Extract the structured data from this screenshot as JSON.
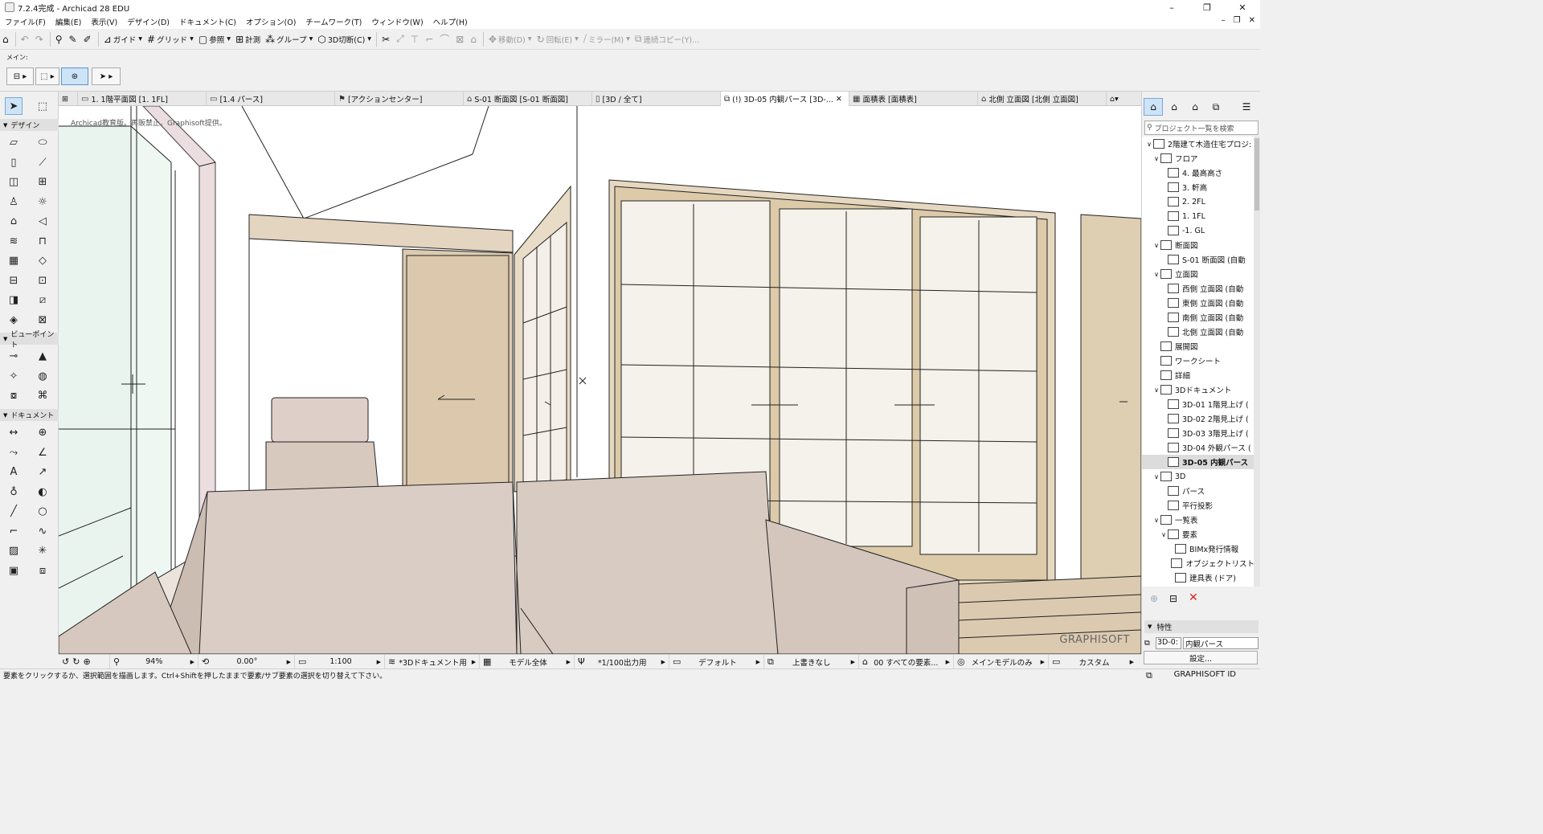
{
  "window": {
    "title": "7.2.4完成 - Archicad 28 EDU",
    "controls": [
      "–",
      "❐",
      "✕"
    ]
  },
  "menu": [
    "ファイル(F)",
    "編集(E)",
    "表示(V)",
    "デザイン(D)",
    "ドキュメント(C)",
    "オプション(O)",
    "チームワーク(T)",
    "ウィンドウ(W)",
    "ヘルプ(H)"
  ],
  "menu_right": [
    "–",
    "❐",
    "✕"
  ],
  "toolbar": {
    "guide": "ガイド",
    "grid": "グリッド",
    "reference": "参照",
    "measure": "計測",
    "group": "グループ",
    "cut3d": "3D切断(C)",
    "move": "移動(D)",
    "rotate": "回転(E)",
    "mirror": "ミラー(M)",
    "multiply": "連続コピー(Y)..."
  },
  "infobox": {
    "label": "メイン:"
  },
  "tabs": [
    {
      "label": "1. 1階平面図 [1. 1FL]",
      "icon": "floorplan-icon"
    },
    {
      "label": "[1.4 パース]",
      "icon": "perspective-icon"
    },
    {
      "label": "[アクションセンター]",
      "icon": "action-center-icon"
    },
    {
      "label": "S-01 断面図 [S-01 断面図]",
      "icon": "section-icon"
    },
    {
      "label": "[3D / 全て]",
      "icon": "3d-icon"
    },
    {
      "label": "(!) 3D-05 内観パース [3D-...",
      "icon": "3d-document-icon",
      "active": true
    },
    {
      "label": "面積表 [面積表]",
      "icon": "schedule-icon"
    },
    {
      "label": "北側 立面図 [北側 立面図]",
      "icon": "elevation-icon"
    }
  ],
  "toolbox": {
    "design": "デザイン",
    "viewpoint": "ビューポイント",
    "document": "ドキュメント"
  },
  "viewport": {
    "watermark": "Archicad教育版。再販禁止。Graphisoft提供。",
    "brand": "GRAPHISOFT"
  },
  "navigator": {
    "search_placeholder": "プロジェクト一覧を検索",
    "tree": [
      {
        "label": "2階建て木造住宅プロジ:",
        "level": 0,
        "chev": "∨"
      },
      {
        "label": "フロア",
        "level": 1,
        "chev": "∨"
      },
      {
        "label": "4. 最高高さ",
        "level": 2,
        "chev": ""
      },
      {
        "label": "3. 軒高",
        "level": 2,
        "chev": ""
      },
      {
        "label": "2. 2FL",
        "level": 2,
        "chev": ""
      },
      {
        "label": "1. 1FL",
        "level": 2,
        "chev": ""
      },
      {
        "label": "-1. GL",
        "level": 2,
        "chev": ""
      },
      {
        "label": "断面図",
        "level": 1,
        "chev": "∨"
      },
      {
        "label": "S-01 断面図 (自動",
        "level": 2,
        "chev": ""
      },
      {
        "label": "立面図",
        "level": 1,
        "chev": "∨"
      },
      {
        "label": "西側 立面図 (自動",
        "level": 2,
        "chev": ""
      },
      {
        "label": "東側 立面図 (自動",
        "level": 2,
        "chev": ""
      },
      {
        "label": "南側 立面図 (自動",
        "level": 2,
        "chev": ""
      },
      {
        "label": "北側 立面図 (自動",
        "level": 2,
        "chev": ""
      },
      {
        "label": "展開図",
        "level": 1,
        "chev": ""
      },
      {
        "label": "ワークシート",
        "level": 1,
        "chev": ""
      },
      {
        "label": "詳細",
        "level": 1,
        "chev": ""
      },
      {
        "label": "3Dドキュメント",
        "level": 1,
        "chev": "∨"
      },
      {
        "label": "3D-01 1階見上げ (",
        "level": 2,
        "chev": ""
      },
      {
        "label": "3D-02 2階見上げ (",
        "level": 2,
        "chev": ""
      },
      {
        "label": "3D-03 3階見上げ (",
        "level": 2,
        "chev": ""
      },
      {
        "label": "3D-04 外観パース (",
        "level": 2,
        "chev": ""
      },
      {
        "label": "3D-05 内観パース",
        "level": 2,
        "chev": "",
        "selected": true
      },
      {
        "label": "3D",
        "level": 1,
        "chev": "∨"
      },
      {
        "label": "パース",
        "level": 2,
        "chev": ""
      },
      {
        "label": "平行投影",
        "level": 2,
        "chev": ""
      },
      {
        "label": "一覧表",
        "level": 1,
        "chev": "∨"
      },
      {
        "label": "要素",
        "level": 2,
        "chev": "∨"
      },
      {
        "label": "BIMx発行情報",
        "level": 3,
        "chev": ""
      },
      {
        "label": "オブジェクトリスト",
        "level": 3,
        "chev": ""
      },
      {
        "label": "建具表 (ドア)",
        "level": 3,
        "chev": ""
      }
    ],
    "properties_title": "特性",
    "prop_id": "3D-0:",
    "prop_name": "内観パース",
    "settings_button": "設定..."
  },
  "statusrow": {
    "zoom": "94%",
    "angle": "0.00°",
    "scale": "1:100",
    "layer": "*3Dドキュメント用",
    "model": "モデル全体",
    "pen": "*1/100出力用",
    "display": "デフォルト",
    "override": "上書きなし",
    "renovation": "00 すべての要素...",
    "model_view": "メインモデルのみ",
    "dim": "カスタム"
  },
  "statusbar": {
    "message": "要素をクリックするか、選択範囲を描画します。Ctrl+Shiftを押したままで要素/サブ要素の選択を切り替えて下さい。",
    "graphisoft_id": "GRAPHISOFT ID"
  }
}
